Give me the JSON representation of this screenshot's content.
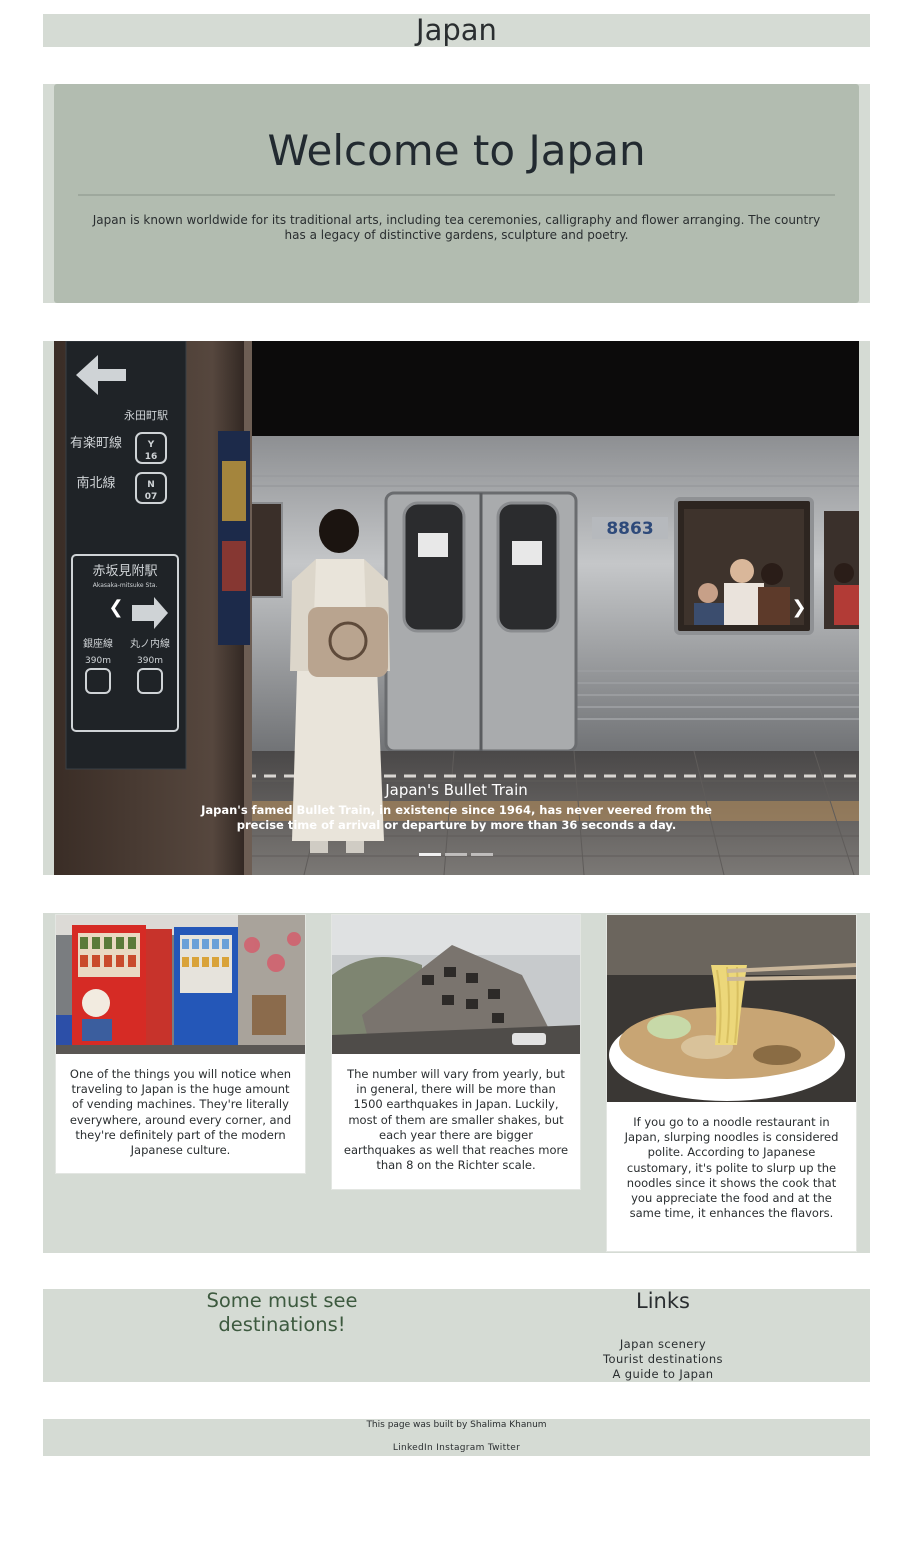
{
  "header": {
    "title": "Japan"
  },
  "jumbotron": {
    "title": "Welcome to Japan",
    "text": "Japan is known worldwide for its traditional arts, including tea ceremonies, calligraphy and flower arranging. The country has a legacy of distinctive gardens, sculpture and poetry."
  },
  "carousel": {
    "caption_title": "Japan's Bullet Train",
    "caption_text": "Japan's famed Bullet Train, in existence since 1964, has never veered from the precise time of arrival or departure by more than 36 seconds a day.",
    "prev_icon": "chevron-left-icon",
    "next_icon": "chevron-right-icon",
    "slide_count": 3,
    "active_slide": 1,
    "scene_text": {
      "station_kanji": "赤坂見附駅",
      "station_romaji": "Akasaka-mitsuke Sta.",
      "car_number": "8863",
      "line1": "有楽町線",
      "line2": "南北線",
      "badge_y": "Y",
      "badge_y_num": "16",
      "badge_n": "N",
      "badge_n_num": "07",
      "line3": "銀座線",
      "line4": "丸ノ内線",
      "dist1": "390m",
      "dist2": "390m",
      "top_sign": "永田町駅"
    }
  },
  "cards": [
    {
      "text": "One of the things you will notice when traveling to Japan is the huge amount of vending machines. They're literally everywhere, around every corner, and they're definitely part of the modern Japanese culture."
    },
    {
      "text": "The number will vary from yearly, but in general, there will be more than 1500 earthquakes in Japan. Luckily, most of them are smaller shakes, but each year there are bigger earthquakes as well that reaches more than 8 on the Richter scale."
    },
    {
      "text": "If you go to a noodle restaurant in Japan, slurping noodles is considered polite. According to Japanese customary, it's polite to slurp up the noodles since it shows the cook that you appreciate the food and at the same time, it enhances the flavors."
    }
  ],
  "destinations": {
    "title": "Some must see destinations!"
  },
  "links": {
    "title": "Links",
    "items": [
      "Japan scenery",
      "Tourist destinations",
      "A guide to Japan"
    ]
  },
  "footer": {
    "credit": "This page was built by Shalima Khanum",
    "social": [
      "LinkedIn",
      "Instagram",
      "Twitter"
    ]
  },
  "colors": {
    "band": "#d5dbd4",
    "jumbotron": "#b2bcb0",
    "accent_green": "#3d5a3f"
  }
}
